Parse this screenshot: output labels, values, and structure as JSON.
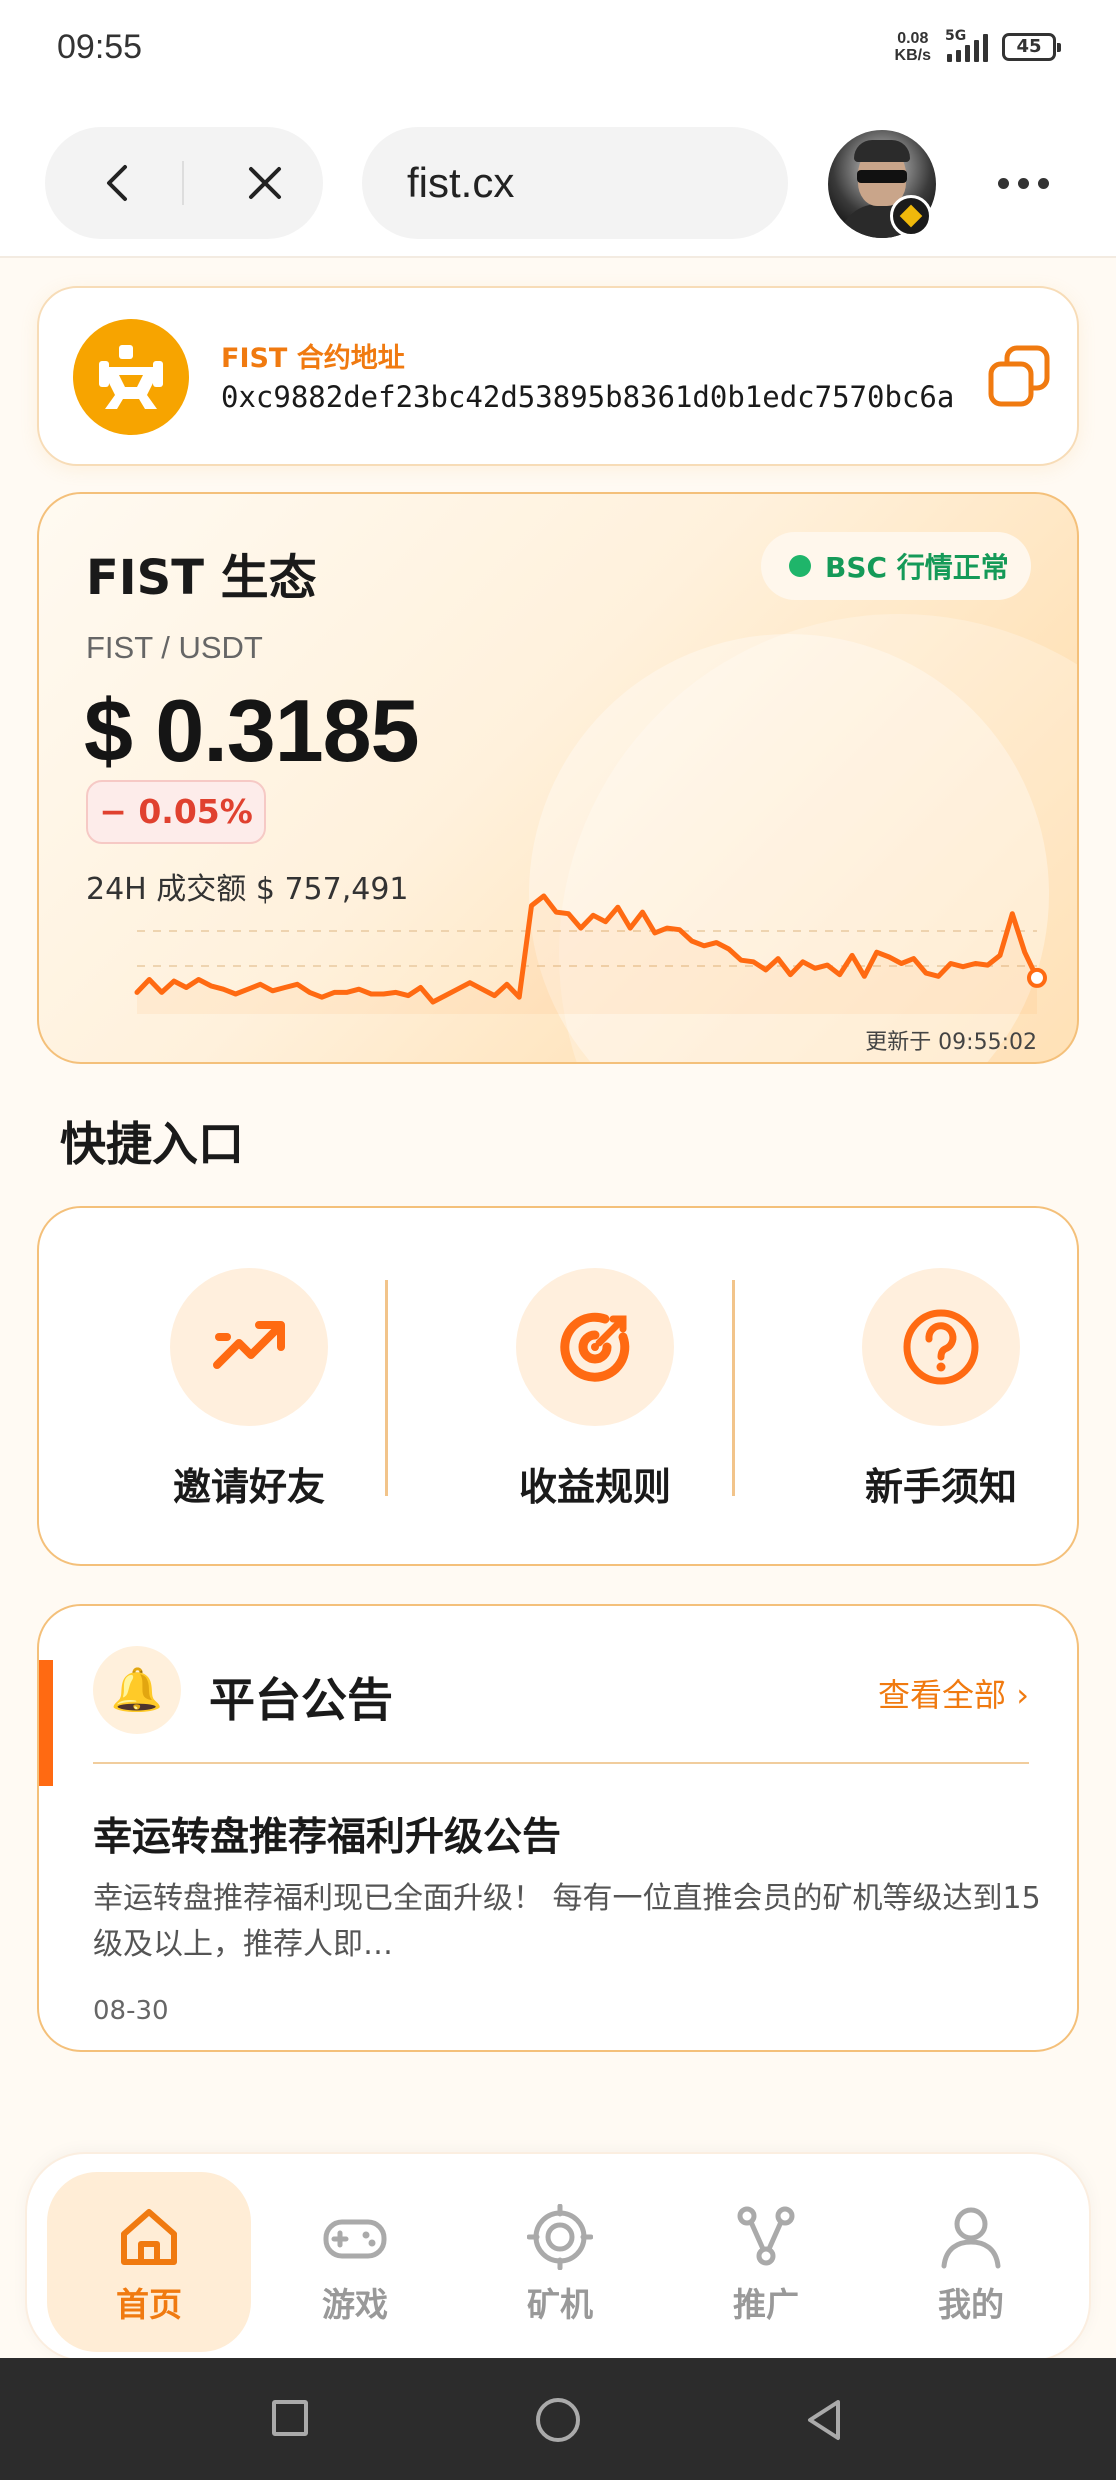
{
  "status_bar": {
    "time": "09:55",
    "net_speed": "0.08",
    "net_unit": "KB/s",
    "network": "5G",
    "battery": "45"
  },
  "browser": {
    "url": "fist.cx",
    "back_icon": "chevron-left-icon",
    "close_icon": "close-icon",
    "more_icon": "more-dots-icon"
  },
  "contract": {
    "title": "FIST 合约地址",
    "address": "0xc9882def23bc42d53895b8361d0b1edc7570bc6a",
    "copy_icon": "copy-icon"
  },
  "market": {
    "title": "FIST 生态",
    "status": "BSC 行情正常",
    "pair": "FIST / USDT",
    "price": "$ 0.3185",
    "change": "− 0.05%",
    "volume_label": "24H 成交额",
    "volume_value": "$ 757,491",
    "updated": "更新于 09:55:02",
    "accent": "#ff6a12"
  },
  "chart_data": {
    "type": "line",
    "values": [
      0.3176,
      0.3184,
      0.3176,
      0.3183,
      0.3179,
      0.3184,
      0.318,
      0.3178,
      0.3175,
      0.3178,
      0.3181,
      0.3177,
      0.3179,
      0.3181,
      0.3176,
      0.3173,
      0.3176,
      0.3176,
      0.3178,
      0.3175,
      0.3175,
      0.3176,
      0.3174,
      0.3179,
      0.317,
      0.3174,
      0.3178,
      0.3182,
      0.3178,
      0.3174,
      0.3181,
      0.3173,
      0.323,
      0.3236,
      0.3226,
      0.3225,
      0.3216,
      0.3224,
      0.322,
      0.3229,
      0.3216,
      0.3226,
      0.3213,
      0.3216,
      0.3215,
      0.3208,
      0.3205,
      0.3207,
      0.3203,
      0.3196,
      0.3195,
      0.319,
      0.3197,
      0.3187,
      0.3195,
      0.3191,
      0.3193,
      0.3187,
      0.3199,
      0.3186,
      0.3201,
      0.3198,
      0.3194,
      0.3197,
      0.3188,
      0.3186,
      0.3194,
      0.3192,
      0.3194,
      0.3193,
      0.3199,
      0.3225,
      0.3201,
      0.3185
    ]
  },
  "quick_entry": {
    "title": "快捷入口",
    "items": [
      {
        "label": "邀请好友",
        "icon": "trending-up-icon"
      },
      {
        "label": "收益规则",
        "icon": "target-icon"
      },
      {
        "label": "新手须知",
        "icon": "help-circle-icon"
      }
    ]
  },
  "notice": {
    "title": "平台公告",
    "view_all": "查看全部 ›",
    "headline": "幸运转盘推荐福利升级公告",
    "body": "幸运转盘推荐福利现已全面升级！ 每有一位直推会员的矿机等级达到15级及以上，推荐人即…",
    "date": "08-30",
    "icon": "bell-icon"
  },
  "tabs": [
    {
      "label": "首页",
      "icon": "home-icon",
      "active": true
    },
    {
      "label": "游戏",
      "icon": "gamepad-icon",
      "active": false
    },
    {
      "label": "矿机",
      "icon": "target-icon",
      "active": false
    },
    {
      "label": "推广",
      "icon": "share-icon",
      "active": false
    },
    {
      "label": "我的",
      "icon": "user-icon",
      "active": false
    }
  ]
}
